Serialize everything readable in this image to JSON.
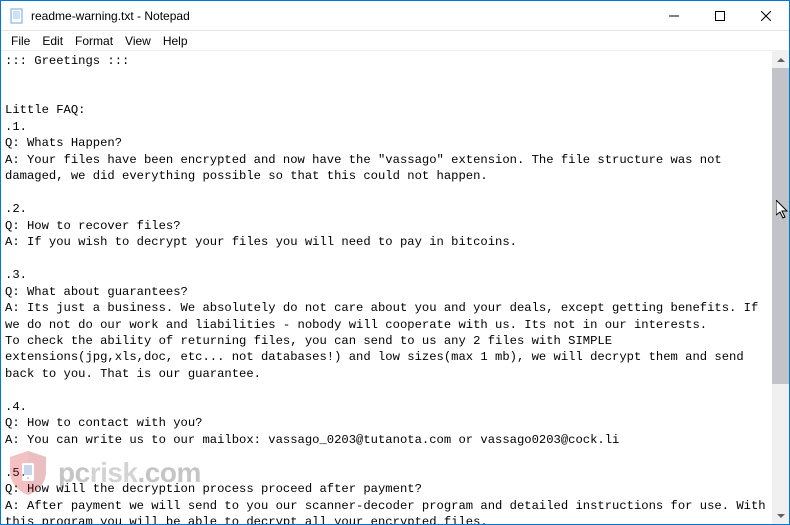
{
  "window": {
    "title": "readme-warning.txt - Notepad"
  },
  "menu": {
    "file": "File",
    "edit": "Edit",
    "format": "Format",
    "view": "View",
    "help": "Help"
  },
  "body_text": "::: Greetings :::\n\n\nLittle FAQ:\n.1.\nQ: Whats Happen?\nA: Your files have been encrypted and now have the \"vassago\" extension. The file structure was not damaged, we did everything possible so that this could not happen.\n\n.2.\nQ: How to recover files?\nA: If you wish to decrypt your files you will need to pay in bitcoins.\n\n.3.\nQ: What about guarantees?\nA: Its just a business. We absolutely do not care about you and your deals, except getting benefits. If we do not do our work and liabilities - nobody will cooperate with us. Its not in our interests.\nTo check the ability of returning files, you can send to us any 2 files with SIMPLE extensions(jpg,xls,doc, etc... not databases!) and low sizes(max 1 mb), we will decrypt them and send back to you. That is our guarantee.\n\n.4.\nQ: How to contact with you?\nA: You can write us to our mailbox: vassago_0203@tutanota.com or vassago0203@cock.li\n\n.5.\nQ: How will the decryption process proceed after payment?\nA: After payment we will send to you our scanner-decoder program and detailed instructions for use. With this program you will be able to decrypt all your encrypted files.",
  "watermark": {
    "brand_a": "pc",
    "brand_b": "risk",
    "tld": ".com"
  }
}
